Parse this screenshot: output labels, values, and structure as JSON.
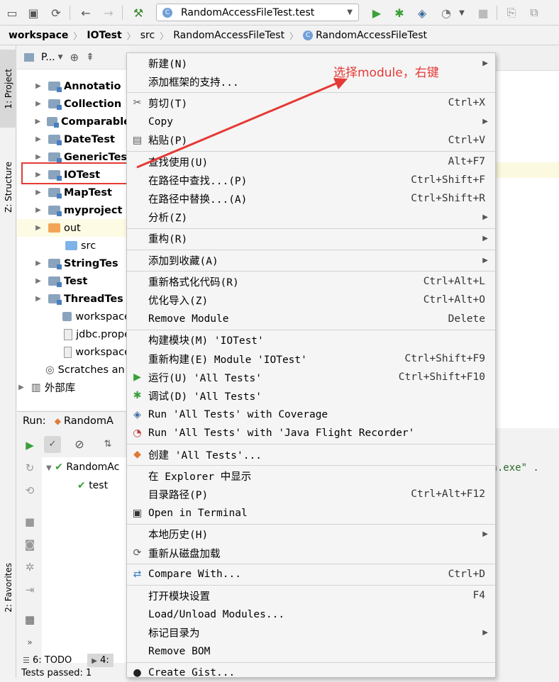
{
  "toolbar": {
    "run_config": "RandomAccessFileTest.test"
  },
  "breadcrumb": [
    "workspace",
    "IOTest",
    "src",
    "RandomAccessFileTest",
    "RandomAccessFileTest"
  ],
  "side_tabs": {
    "project": "1: Project",
    "structure": "Z: Structure",
    "favorites": "2: Favorites"
  },
  "project_panel": {
    "title": "P...",
    "items": [
      {
        "label": "Annotatio",
        "kind": "module"
      },
      {
        "label": "Collection",
        "kind": "module"
      },
      {
        "label": "Comparable",
        "kind": "module"
      },
      {
        "label": "DateTest",
        "kind": "module"
      },
      {
        "label": "GenericTes",
        "kind": "module"
      },
      {
        "label": "IOTest",
        "kind": "module"
      },
      {
        "label": "MapTest",
        "kind": "module"
      },
      {
        "label": "myproject",
        "kind": "module"
      },
      {
        "label": "out",
        "kind": "out"
      },
      {
        "label": "src",
        "kind": "src"
      },
      {
        "label": "StringTes",
        "kind": "module"
      },
      {
        "label": "Test",
        "kind": "module"
      },
      {
        "label": "ThreadTes",
        "kind": "module"
      },
      {
        "label": "workspace",
        "kind": "folder"
      },
      {
        "label": "jdbc.prope",
        "kind": "file"
      },
      {
        "label": "workspace",
        "kind": "file"
      },
      {
        "label": "Scratches an",
        "kind": "scratch"
      },
      {
        "label": "外部库",
        "kind": "lib"
      }
    ]
  },
  "run_panel": {
    "label": "Run:",
    "tab": "RandomA",
    "tree": [
      "RandomAc",
      "test"
    ]
  },
  "bottom_tabs": [
    "6: TODO",
    "4:"
  ],
  "status": "Tests passed: 1",
  "editor": {
    "console_text": "va.exe\" ."
  },
  "annotation": "选择module，右键",
  "context_menu": {
    "groups": [
      [
        {
          "label": "新建(N)",
          "submenu": true
        },
        {
          "label": "添加框架的支持..."
        }
      ],
      [
        {
          "label": "剪切(T)",
          "shortcut": "Ctrl+X",
          "icon": "cut-icon"
        },
        {
          "label": "Copy",
          "submenu": true
        },
        {
          "label": "粘贴(P)",
          "shortcut": "Ctrl+V",
          "icon": "paste-icon"
        }
      ],
      [
        {
          "label": "查找使用(U)",
          "shortcut": "Alt+F7"
        },
        {
          "label": "在路径中查找...(P)",
          "shortcut": "Ctrl+Shift+F"
        },
        {
          "label": "在路径中替换...(A)",
          "shortcut": "Ctrl+Shift+R"
        },
        {
          "label": "分析(Z)",
          "submenu": true
        }
      ],
      [
        {
          "label": "重构(R)",
          "submenu": true
        }
      ],
      [
        {
          "label": "添加到收藏(A)",
          "submenu": true
        }
      ],
      [
        {
          "label": "重新格式化代码(R)",
          "shortcut": "Ctrl+Alt+L"
        },
        {
          "label": "优化导入(Z)",
          "shortcut": "Ctrl+Alt+O"
        },
        {
          "label": "Remove Module",
          "shortcut": "Delete"
        }
      ],
      [
        {
          "label": "构建模块(M) 'IOTest'"
        },
        {
          "label": "重新构建(E) Module 'IOTest'",
          "shortcut": "Ctrl+Shift+F9"
        },
        {
          "label": "运行(U) 'All Tests'",
          "shortcut": "Ctrl+Shift+F10",
          "icon": "run-icon"
        },
        {
          "label": "调试(D) 'All Tests'",
          "icon": "debug-icon"
        },
        {
          "label": "Run 'All Tests' with Coverage",
          "icon": "coverage-icon"
        },
        {
          "label": "Run 'All Tests' with 'Java Flight Recorder'",
          "icon": "profiler-icon"
        }
      ],
      [
        {
          "label": "创建 'All Tests'...",
          "icon": "create-config-icon"
        }
      ],
      [
        {
          "label": "在 Explorer 中显示"
        },
        {
          "label": "目录路径(P)",
          "shortcut": "Ctrl+Alt+F12"
        },
        {
          "label": "Open in Terminal",
          "icon": "terminal-icon"
        }
      ],
      [
        {
          "label": "本地历史(H)",
          "submenu": true
        },
        {
          "label": "重新从磁盘加载",
          "icon": "reload-icon"
        }
      ],
      [
        {
          "label": "Compare With...",
          "shortcut": "Ctrl+D",
          "icon": "compare-icon"
        }
      ],
      [
        {
          "label": "打开模块设置",
          "shortcut": "F4"
        },
        {
          "label": "Load/Unload Modules..."
        },
        {
          "label": "标记目录为",
          "submenu": true
        },
        {
          "label": "Remove BOM"
        }
      ],
      [
        {
          "label": "Create Gist...",
          "icon": "github-icon"
        }
      ]
    ]
  }
}
